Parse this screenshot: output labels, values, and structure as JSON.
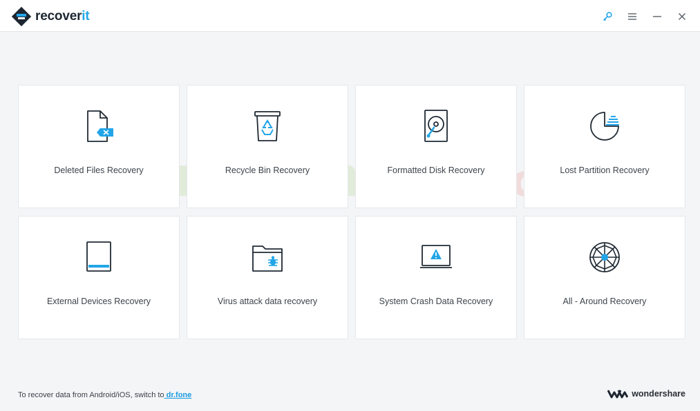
{
  "app": {
    "name_prefix": "recover",
    "name_suffix": "it"
  },
  "window_controls": {
    "icons": [
      "key-icon",
      "menu-icon",
      "minimize-icon",
      "close-icon"
    ]
  },
  "cards": [
    {
      "label": "Deleted Files Recovery",
      "icon": "deleted-file-icon"
    },
    {
      "label": "Recycle Bin Recovery",
      "icon": "recycle-bin-icon"
    },
    {
      "label": "Formatted Disk Recovery",
      "icon": "hard-disk-icon"
    },
    {
      "label": "Lost Partition Recovery",
      "icon": "partition-pie-icon"
    },
    {
      "label": "External Devices Recovery",
      "icon": "external-device-icon"
    },
    {
      "label": "Virus attack data recovery",
      "icon": "virus-folder-icon"
    },
    {
      "label": "System Crash Data Recovery",
      "icon": "crash-monitor-icon"
    },
    {
      "label": "All - Around Recovery",
      "icon": "all-around-web-icon"
    }
  ],
  "watermark": {
    "main": "phanmem333",
    "suffix": ".com"
  },
  "footer": {
    "text": "To recover data from Android/iOS, switch to",
    "link": " dr.fone"
  },
  "brand": {
    "name": "wondershare"
  },
  "colors": {
    "accent": "#22a5e8",
    "icon_stroke": "#1f2933",
    "background": "#f4f5f7",
    "card": "#ffffff"
  }
}
